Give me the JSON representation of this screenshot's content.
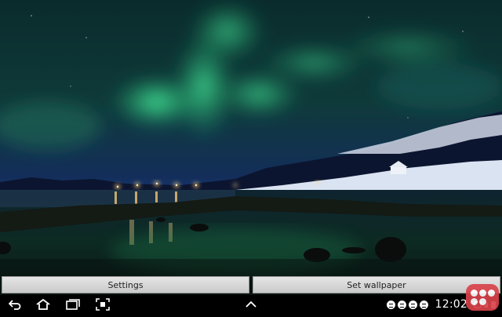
{
  "wallpaper": {
    "description_icon": "aurora-wallpaper-image",
    "colors": {
      "sky_top": "#0b2a2a",
      "aurora": "#3bd98a",
      "horizon": "#1d3d80",
      "snow": "#dce6f2",
      "lights": "#ffd27a"
    }
  },
  "actions": {
    "settings_label": "Settings",
    "set_wallpaper_label": "Set wallpaper"
  },
  "navbar": {
    "back_icon": "back-icon",
    "home_icon": "home-icon",
    "recent_icon": "recent-apps-icon",
    "screenshot_icon": "screenshot-icon",
    "up_icon": "chevron-up-icon",
    "notification_icons": [
      "chat-icon",
      "chat-icon",
      "chat-icon",
      "chat-icon"
    ],
    "time": "12:02"
  }
}
